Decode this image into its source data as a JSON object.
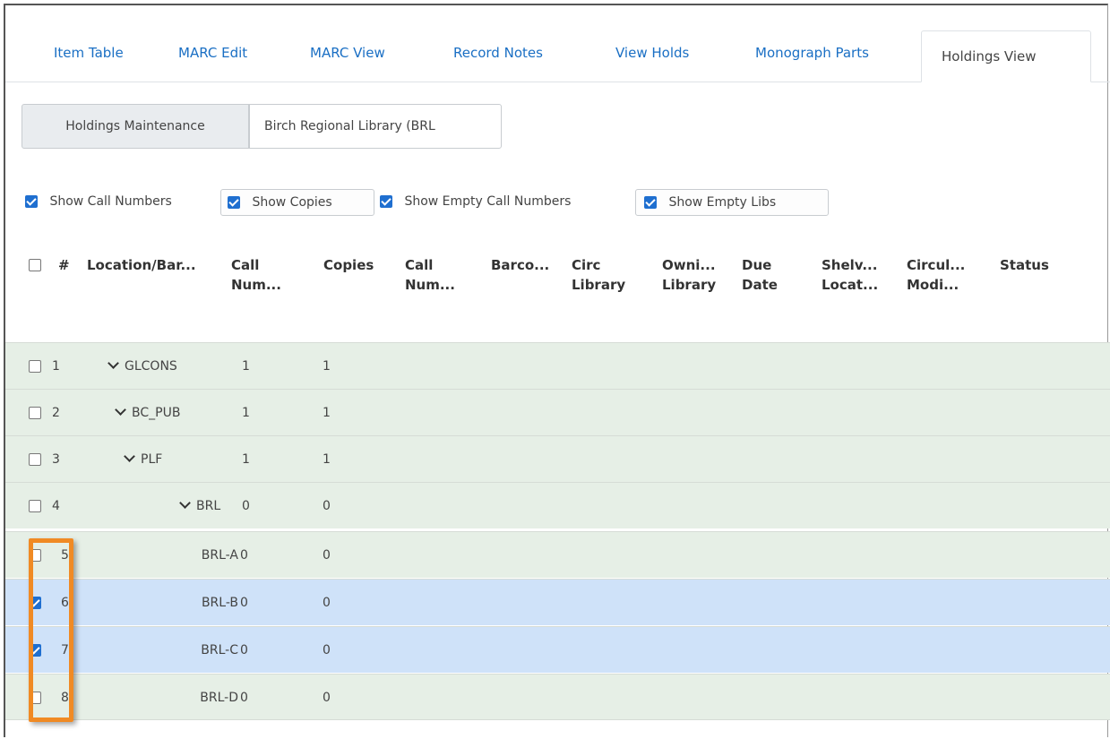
{
  "tabs": [
    {
      "label": "Item Table",
      "active": false
    },
    {
      "label": "MARC Edit",
      "active": false
    },
    {
      "label": "MARC View",
      "active": false
    },
    {
      "label": "Record Notes",
      "active": false
    },
    {
      "label": "View Holds",
      "active": false
    },
    {
      "label": "Monograph Parts",
      "active": false
    },
    {
      "label": "Holdings View",
      "active": true
    }
  ],
  "toolbar": {
    "maintenance_label": "Holdings Maintenance",
    "library_select_value": "Birch Regional Library (BRL"
  },
  "options": [
    {
      "label": "Show Call Numbers",
      "checked": true
    },
    {
      "label": "Show Copies",
      "checked": true
    },
    {
      "label": "Show Empty Call Numbers",
      "checked": true
    },
    {
      "label": "Show Empty Libs",
      "checked": true
    }
  ],
  "grid": {
    "headers": {
      "num": "#",
      "location": "Location/Bar...",
      "callnum1": [
        "Call",
        "Num..."
      ],
      "copies": "Copies",
      "callnum2": [
        "Call",
        "Num..."
      ],
      "barcode": "Barco...",
      "circ_library": [
        "Circ",
        "Library"
      ],
      "owning_library": [
        "Owni...",
        "Library"
      ],
      "due_date": [
        "Due",
        "Date"
      ],
      "shelving": [
        "Shelv...",
        "Locat..."
      ],
      "circ_modifier": [
        "Circul...",
        "Modi..."
      ],
      "status": "Status"
    },
    "rows": [
      {
        "num": "1",
        "location": "GLCONS",
        "call_numbers": "1",
        "copies": "1",
        "expanded": true,
        "checked": false,
        "selected": false
      },
      {
        "num": "2",
        "location": "BC_PUB",
        "call_numbers": "1",
        "copies": "1",
        "expanded": true,
        "checked": false,
        "selected": false
      },
      {
        "num": "3",
        "location": "PLF",
        "call_numbers": "1",
        "copies": "1",
        "expanded": true,
        "checked": false,
        "selected": false
      },
      {
        "num": "4",
        "location": "BRL",
        "call_numbers": "0",
        "copies": "0",
        "expanded": true,
        "checked": false,
        "selected": false
      },
      {
        "num": "5",
        "location": "BRL-A",
        "call_numbers": "0",
        "copies": "0",
        "expanded": false,
        "checked": false,
        "selected": false
      },
      {
        "num": "6",
        "location": "BRL-B",
        "call_numbers": "0",
        "copies": "0",
        "expanded": false,
        "checked": true,
        "selected": true
      },
      {
        "num": "7",
        "location": "BRL-C",
        "call_numbers": "0",
        "copies": "0",
        "expanded": false,
        "checked": true,
        "selected": true
      },
      {
        "num": "8",
        "location": "BRL-D",
        "call_numbers": "0",
        "copies": "0",
        "expanded": false,
        "checked": false,
        "selected": false
      }
    ]
  },
  "colors": {
    "tab_link": "#1a6fc4",
    "row_green": "#e6efe6",
    "row_selected": "#cfe2f9",
    "checkbox_checked": "#1f6fd0",
    "highlight": "#f08a24"
  }
}
